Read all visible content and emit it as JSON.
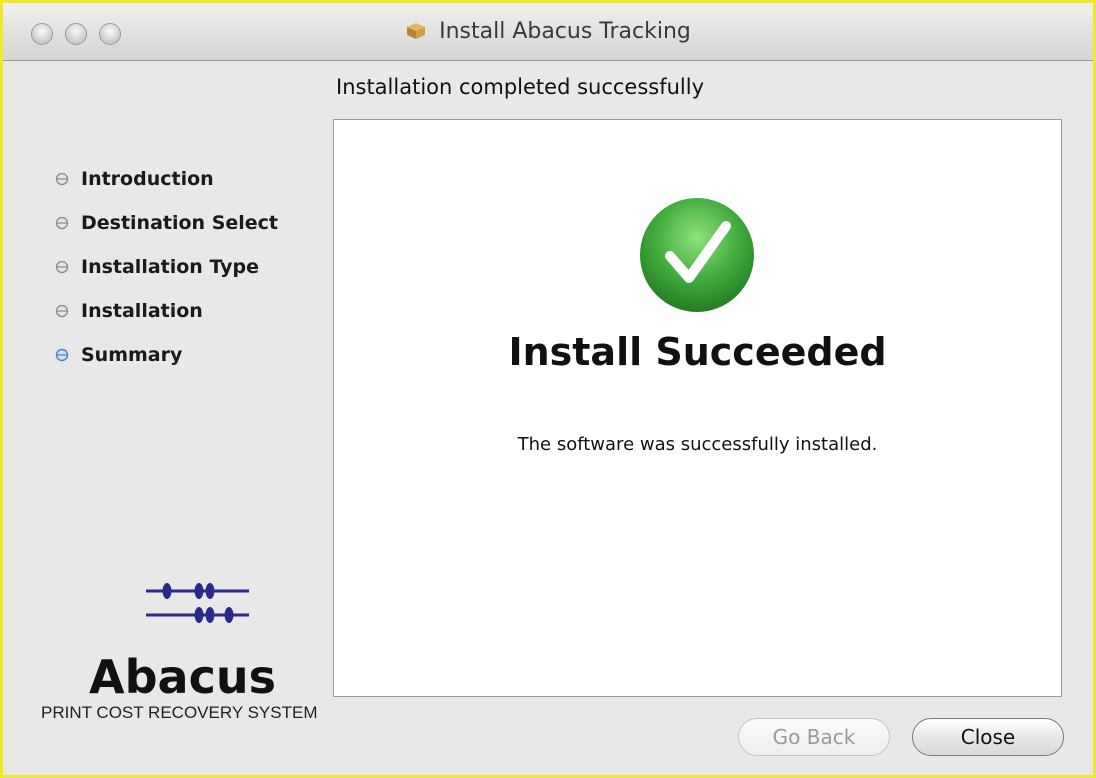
{
  "window": {
    "title": "Install Abacus Tracking"
  },
  "page": {
    "heading": "Installation completed successfully"
  },
  "sidebar": {
    "steps": [
      {
        "label": "Introduction",
        "active": false
      },
      {
        "label": "Destination Select",
        "active": false
      },
      {
        "label": "Installation Type",
        "active": false
      },
      {
        "label": "Installation",
        "active": false
      },
      {
        "label": "Summary",
        "active": true
      }
    ],
    "logo_text": "Abacus",
    "tagline": "PRINT COST RECOVERY SYSTEM"
  },
  "main": {
    "status_icon": "checkmark-circle-icon",
    "title": "Install Succeeded",
    "message": "The software was successfully installed."
  },
  "buttons": {
    "back": {
      "label": "Go Back",
      "enabled": false
    },
    "close": {
      "label": "Close",
      "enabled": true
    }
  },
  "colors": {
    "active_bullet": "#4a7fd0",
    "inactive_bullet": "#8a8a8a",
    "success_green": "#39a33a",
    "logo_navy": "#2b2a8c"
  }
}
